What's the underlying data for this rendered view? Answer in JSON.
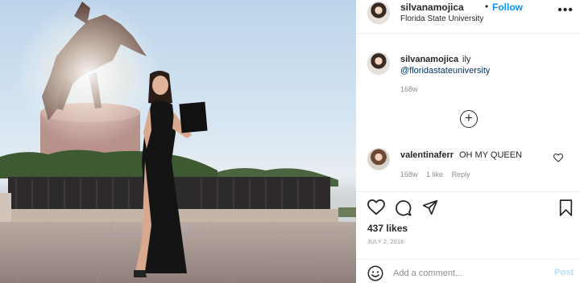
{
  "header": {
    "username": "silvanamojica",
    "separator": "•",
    "follow_label": "Follow",
    "location": "Florida State University",
    "more_icon": "more-horizontal-icon"
  },
  "caption": {
    "username": "silvanamojica",
    "text": "ily",
    "mention": "@floridastateuniversity",
    "time": "168w"
  },
  "load_more_icon": "plus-circle-icon",
  "comment": {
    "username": "valentinaferr",
    "text": "OH MY QUEEN",
    "time": "168w",
    "likes": "1 like",
    "reply_label": "Reply"
  },
  "actions": {
    "likes": "437 likes",
    "date": "JULY 2, 2018"
  },
  "add_comment": {
    "placeholder": "Add a comment...",
    "post_label": "Post"
  },
  "colors": {
    "accent": "#0095f6",
    "mention": "#00376b",
    "post_disabled": "#b2dffc",
    "muted": "#8e8e8e"
  }
}
